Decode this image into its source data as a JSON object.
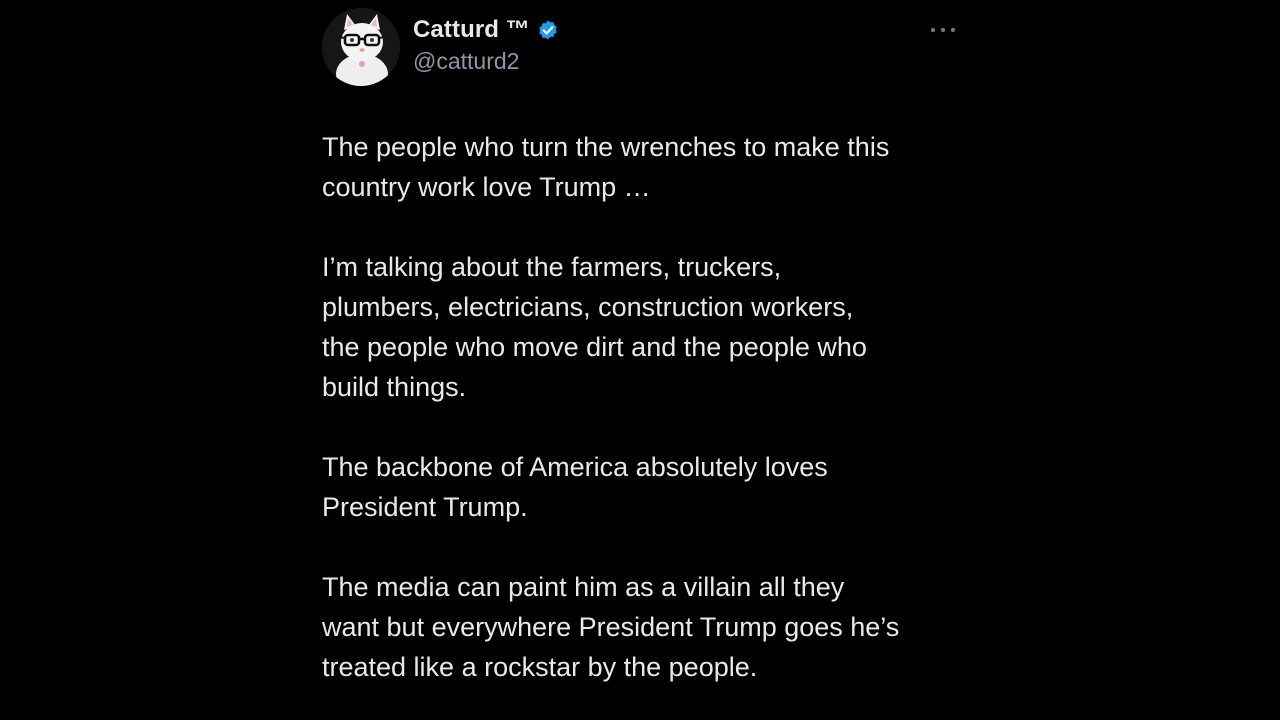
{
  "tweet": {
    "author": {
      "display_name": "Catturd ™",
      "handle": "@catturd2",
      "verified": true,
      "avatar_icon": "cat-with-glasses-avatar",
      "verified_color": "#1d9bf0"
    },
    "more_icon": "ellipsis-icon",
    "paragraphs": [
      "The people who turn the wrenches to make this\ncountry work love Trump  …",
      "I’m talking about the farmers, truckers,\nplumbers, electricians, construction workers,\nthe people who move dirt and the people who\nbuild things.",
      "The backbone of America absolutely loves\nPresident Trump.",
      "The media can paint him as a villain all they\nwant but everywhere President Trump goes he’s\ntreated like a rockstar by the people."
    ]
  },
  "colors": {
    "background": "#000000",
    "text": "#e7e9ea",
    "secondary_text": "#8b98a5"
  }
}
